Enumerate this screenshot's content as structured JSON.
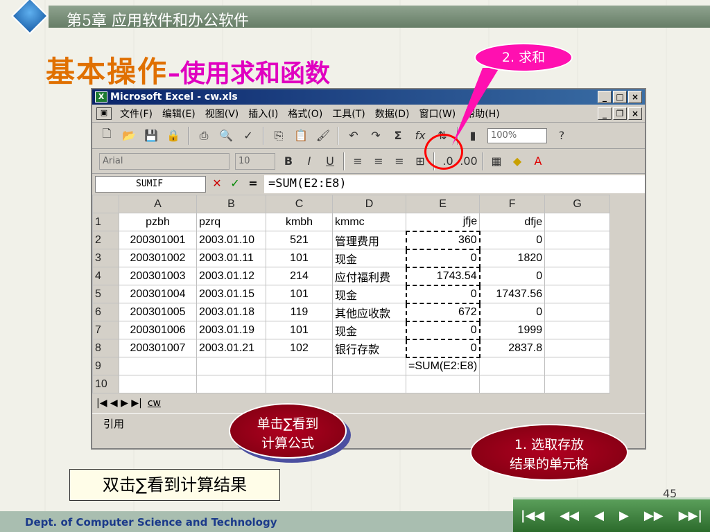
{
  "slide": {
    "chapter": "第5章 应用软件和办公软件",
    "title_main": "基本操作",
    "title_sub": "–使用求和函数",
    "page_number": "45",
    "department": "Dept. of Computer Science and Technology"
  },
  "callouts": {
    "sum_step": "2. 求和",
    "sigma_note_line1": "单击∑看到",
    "sigma_note_line2": "计算公式",
    "select_note_line1": "1. 选取存放",
    "select_note_line2": "结果的单元格",
    "double_click_note": "双击∑看到计算结果"
  },
  "excel": {
    "window_title": "Microsoft Excel - cw.xls",
    "menus": [
      "文件(F)",
      "编辑(E)",
      "视图(V)",
      "插入(I)",
      "格式(O)",
      "工具(T)",
      "数据(D)",
      "窗口(W)",
      "帮助(H)"
    ],
    "zoom": "100%",
    "font": "Arial",
    "font_size": "10",
    "name_box": "SUMIF",
    "formula": "=SUM(E2:E8)",
    "sheet_tab": "cw",
    "status": "引用",
    "columns": [
      "A",
      "B",
      "C",
      "D",
      "E",
      "F",
      "G"
    ],
    "rows": [
      {
        "n": "1",
        "a": "pzbh",
        "b": "pzrq",
        "c": "kmbh",
        "d": "kmmc",
        "e": "jfje",
        "f": "dfje"
      },
      {
        "n": "2",
        "a": "200301001",
        "b": "2003.01.10",
        "c": "521",
        "d": "管理费用",
        "e": "360",
        "f": "0"
      },
      {
        "n": "3",
        "a": "200301002",
        "b": "2003.01.11",
        "c": "101",
        "d": "现金",
        "e": "0",
        "f": "1820"
      },
      {
        "n": "4",
        "a": "200301003",
        "b": "2003.01.12",
        "c": "214",
        "d": "应付福利费",
        "e": "1743.54",
        "f": "0"
      },
      {
        "n": "5",
        "a": "200301004",
        "b": "2003.01.15",
        "c": "101",
        "d": "现金",
        "e": "0",
        "f": "17437.56"
      },
      {
        "n": "6",
        "a": "200301005",
        "b": "2003.01.18",
        "c": "119",
        "d": "其他应收款",
        "e": "672",
        "f": "0"
      },
      {
        "n": "7",
        "a": "200301006",
        "b": "2003.01.19",
        "c": "101",
        "d": "现金",
        "e": "0",
        "f": "1999"
      },
      {
        "n": "8",
        "a": "200301007",
        "b": "2003.01.21",
        "c": "102",
        "d": "银行存款",
        "e": "0",
        "f": "2837.8"
      },
      {
        "n": "9",
        "a": "",
        "b": "",
        "c": "",
        "d": "",
        "e": "=SUM(E2:E8)",
        "f": ""
      },
      {
        "n": "10",
        "a": "",
        "b": "",
        "c": "",
        "d": "",
        "e": "",
        "f": ""
      }
    ]
  },
  "colors": {
    "title": "#e07000",
    "subtitle": "#e000c0",
    "callout_pink": "#ff10b0",
    "callout_red": "#9a0018"
  }
}
